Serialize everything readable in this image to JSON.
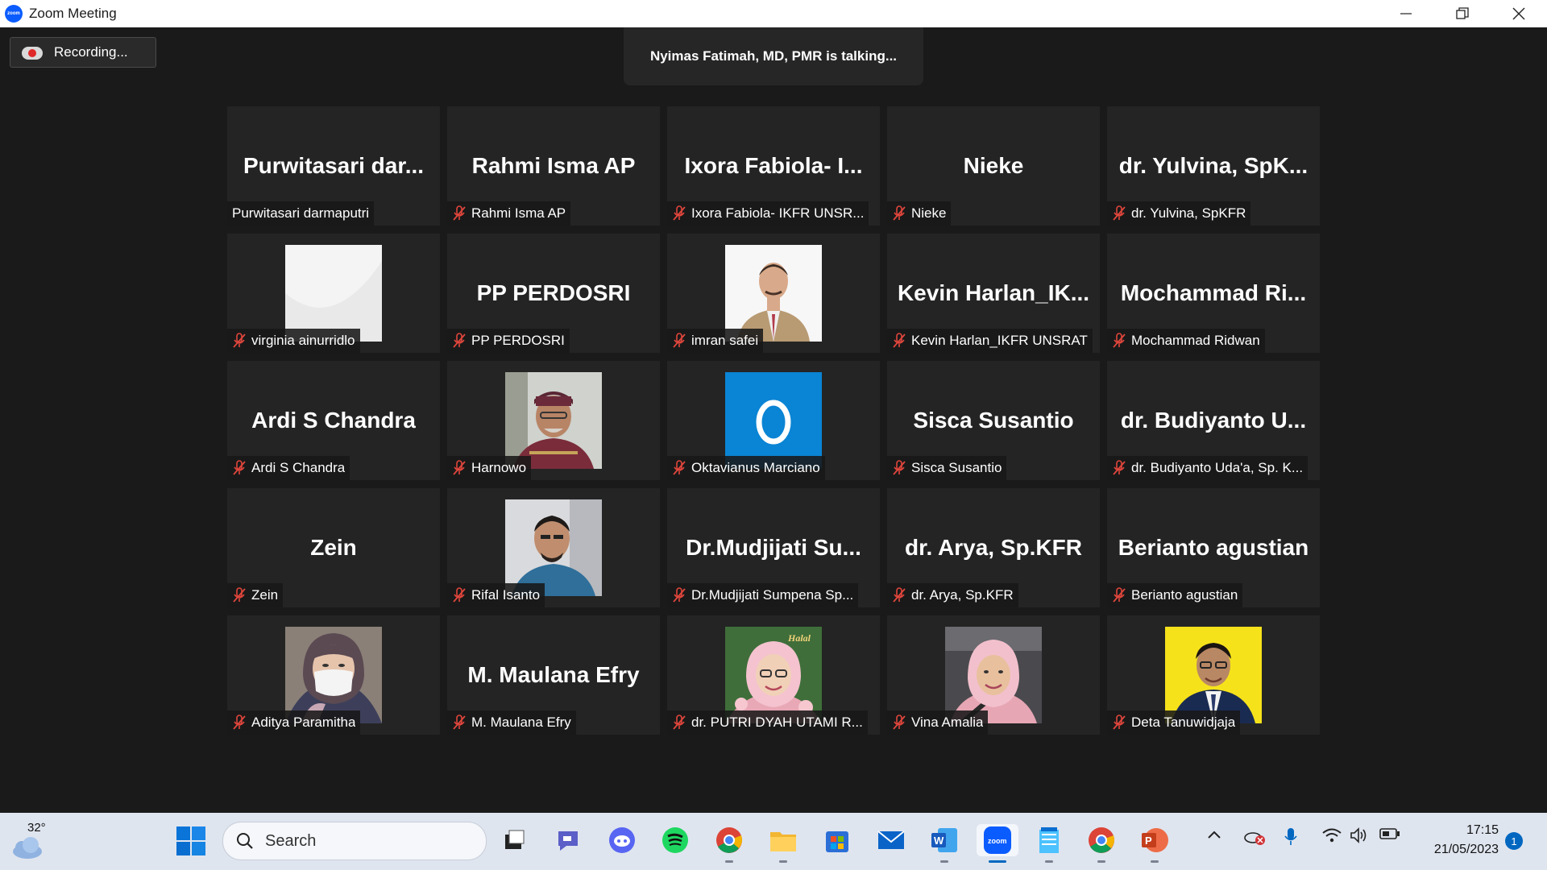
{
  "window": {
    "title": "Zoom Meeting"
  },
  "recording": {
    "label": "Recording..."
  },
  "talking": {
    "text": "Nyimas Fatimah, MD, PMR is talking..."
  },
  "participants": [
    {
      "display": "Purwitasari  dar...",
      "name": "Purwitasari darmaputri",
      "muted": false,
      "photo": ""
    },
    {
      "display": "Rahmi Isma AP",
      "name": "Rahmi Isma AP",
      "muted": true,
      "photo": ""
    },
    {
      "display": "Ixora  Fabiola-  I...",
      "name": "Ixora Fabiola- IKFR UNSR...",
      "muted": true,
      "photo": ""
    },
    {
      "display": "Nieke",
      "name": "Nieke",
      "muted": true,
      "photo": ""
    },
    {
      "display": "dr.  Yulvina,  SpK...",
      "name": "dr. Yulvina, SpKFR",
      "muted": true,
      "photo": ""
    },
    {
      "display": "",
      "name": "virginia ainurridlo",
      "muted": true,
      "photo": "white"
    },
    {
      "display": "PP PERDOSRI",
      "name": "PP PERDOSRI",
      "muted": true,
      "photo": ""
    },
    {
      "display": "",
      "name": "imran safei",
      "muted": true,
      "photo": "man-suit"
    },
    {
      "display": "Kevin  Harlan_IK...",
      "name": "Kevin Harlan_IKFR UNSRAT",
      "muted": true,
      "photo": ""
    },
    {
      "display": "Mochammad  Ri...",
      "name": "Mochammad Ridwan",
      "muted": true,
      "photo": ""
    },
    {
      "display": "Ardi S Chandra",
      "name": "Ardi S Chandra",
      "muted": true,
      "photo": ""
    },
    {
      "display": "",
      "name": "Harnowo",
      "muted": true,
      "photo": "man-cap"
    },
    {
      "display": "",
      "name": "Oktavianus Marciano",
      "muted": true,
      "photo": "letter-O"
    },
    {
      "display": "Sisca Susantio",
      "name": "Sisca Susantio",
      "muted": true,
      "photo": ""
    },
    {
      "display": "dr.  Budiyanto  U...",
      "name": "dr. Budiyanto Uda'a, Sp. K...",
      "muted": true,
      "photo": ""
    },
    {
      "display": "Zein",
      "name": "Zein",
      "muted": true,
      "photo": ""
    },
    {
      "display": "",
      "name": "Rifal Isanto",
      "muted": true,
      "photo": "man-selfie"
    },
    {
      "display": "Dr.Mudjijati  Su...",
      "name": "Dr.Mudjijati Sumpena Sp...",
      "muted": true,
      "photo": ""
    },
    {
      "display": "dr. Arya, Sp.KFR",
      "name": "dr. Arya, Sp.KFR",
      "muted": true,
      "photo": ""
    },
    {
      "display": "Berianto agustian",
      "name": "Berianto agustian",
      "muted": true,
      "photo": ""
    },
    {
      "display": "",
      "name": "Aditya Paramitha",
      "muted": true,
      "photo": "woman-mask"
    },
    {
      "display": "M. Maulana Efry",
      "name": "M. Maulana Efry",
      "muted": true,
      "photo": ""
    },
    {
      "display": "",
      "name": "dr. PUTRI DYAH UTAMI R...",
      "muted": true,
      "photo": "woman-hijab"
    },
    {
      "display": "",
      "name": "Vina Amalia",
      "muted": true,
      "photo": "woman-car"
    },
    {
      "display": "",
      "name": "Deta Tanuwidjaja",
      "muted": true,
      "photo": "man-yellow"
    }
  ],
  "taskbar": {
    "temperature": "32°",
    "search_placeholder": "Search",
    "time": "17:15",
    "date": "21/05/2023",
    "notifications": "1"
  },
  "colors": {
    "accent": "#0b5cff",
    "muted_mic": "#e0463c",
    "tile_bg": "#242424"
  }
}
